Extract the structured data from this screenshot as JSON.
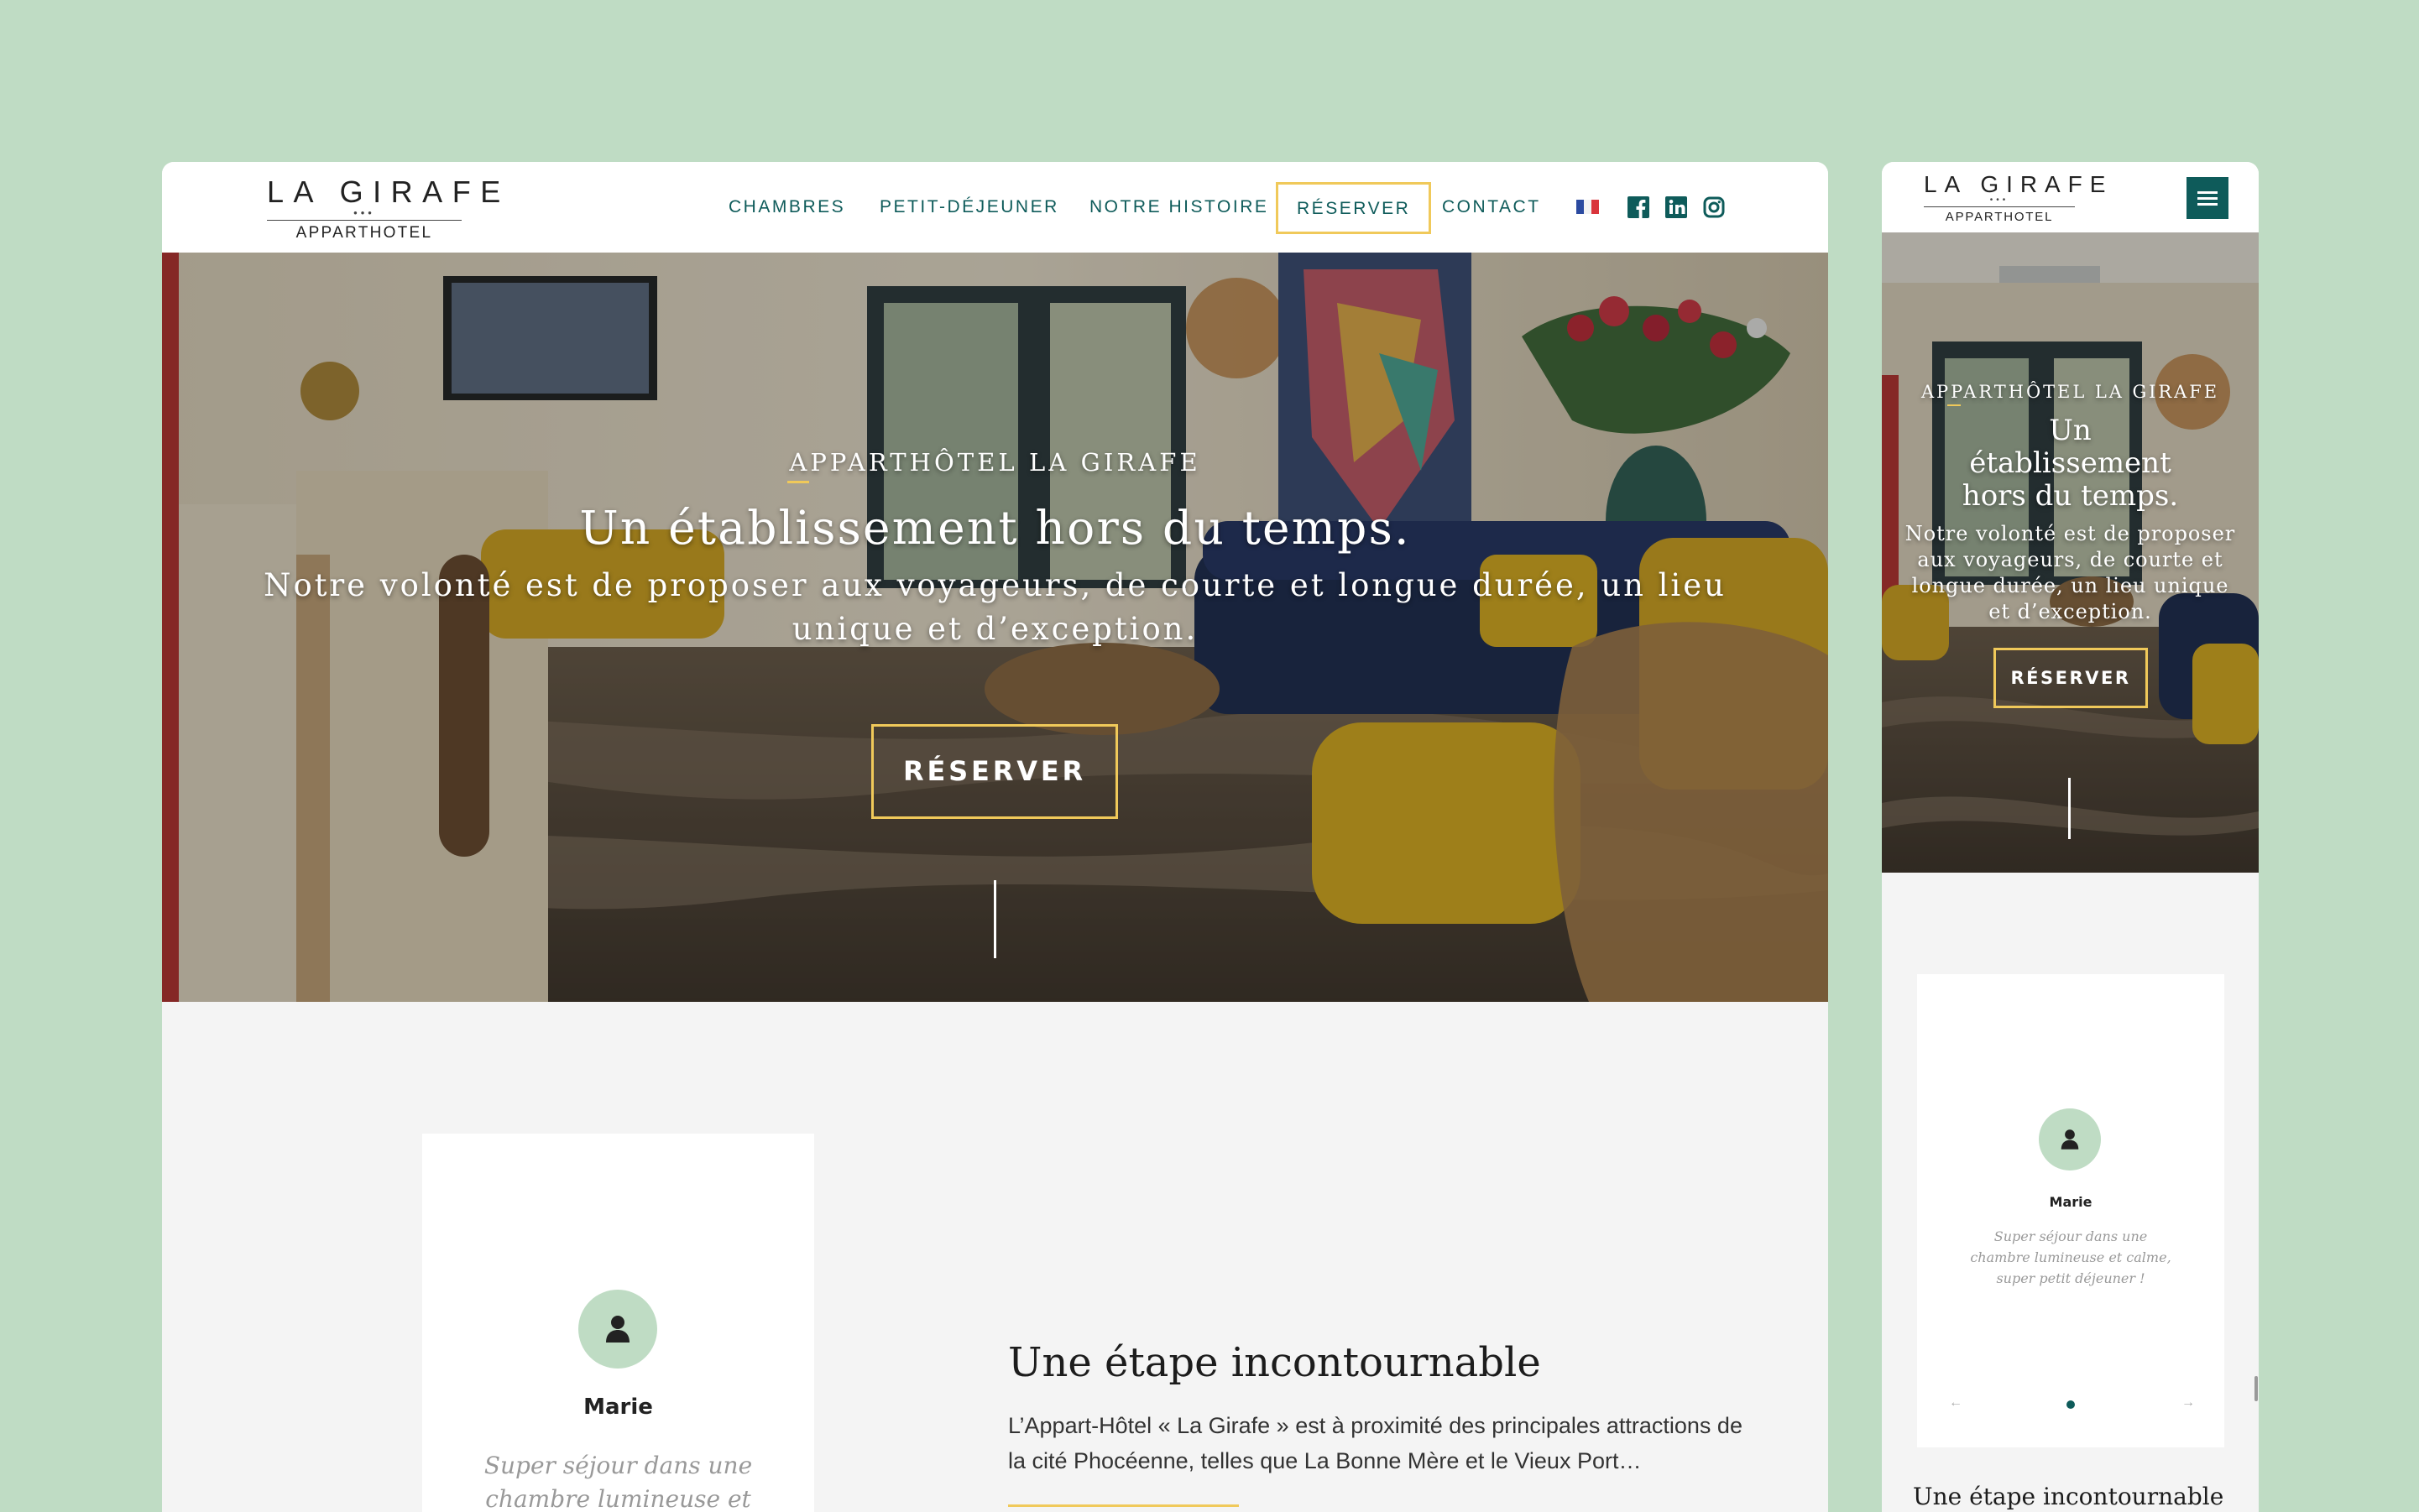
{
  "brand": {
    "name": "LA GIRAFE",
    "stars": "•••",
    "subtitle": "APPARTHOTEL"
  },
  "nav": {
    "items": [
      {
        "label": "CHAMBRES"
      },
      {
        "label": "PETIT-DÉJEUNER"
      },
      {
        "label": "NOTRE HISTOIRE"
      },
      {
        "label": "RÉSERVER",
        "highlighted": true
      },
      {
        "label": "CONTACT"
      }
    ],
    "language_flag": "fr-flag-icon",
    "social": [
      "facebook-icon",
      "linkedin-icon",
      "instagram-icon"
    ]
  },
  "hero": {
    "eyebrow": "APPARTHÔTEL LA GIRAFE",
    "title": "Un établissement hors du temps.",
    "lead": "Notre volonté est de proposer aux voyageurs, de courte et longue durée, un lieu unique et d’exception.",
    "button": "RÉSERVER"
  },
  "review": {
    "name": "Marie",
    "quote_desktop": "Super séjour dans une chambre lumineuse et calme",
    "quote_mobile": "Super séjour dans une chambre lumineuse et calme, super petit déjeuner !",
    "prev_icon": "←",
    "next_icon": "→"
  },
  "section": {
    "title": "Une étape incontournable",
    "body": "L’Appart-Hôtel « La Girafe » est à proximité des principales attractions de la cité Phocéenne, telles que La Bonne Mère et le Vieux Port…"
  },
  "colors": {
    "background": "#bfdcc4",
    "accent": "#f0c95a",
    "brand": "#0e5b5a",
    "panel": "#f4f4f4"
  }
}
